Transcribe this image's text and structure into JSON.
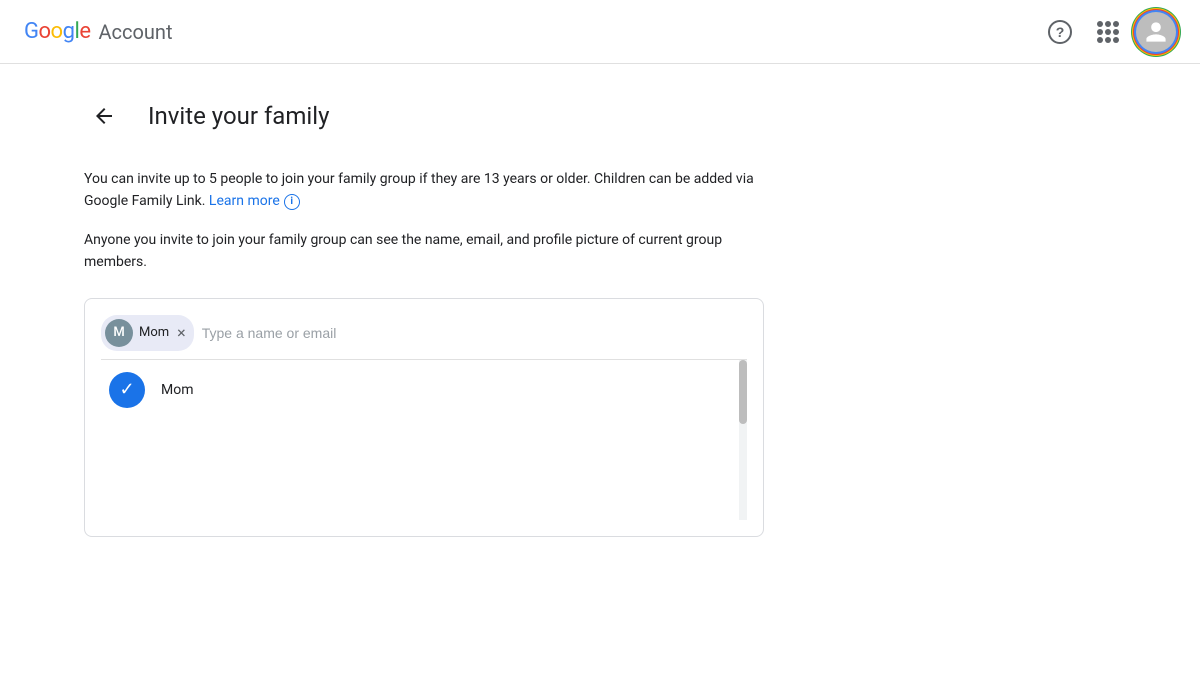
{
  "header": {
    "google_logo": {
      "g": "G",
      "o1": "o",
      "o2": "o",
      "g2": "g",
      "l": "l",
      "e": "e"
    },
    "account_text": "Account",
    "help_label": "?",
    "apps_label": "Google apps",
    "profile_label": "Google Account"
  },
  "page": {
    "back_label": "←",
    "title": "Invite your family",
    "description1": "You can invite up to 5 people to join your family group if they are 13 years or older. Children can be added via Google Family Link.",
    "learn_more_text": "Learn more",
    "learn_more_icon": "ℹ",
    "description2": "Anyone you invite to join your family group can see the name, email, and profile picture of current group members."
  },
  "input": {
    "chip_label": "Mom",
    "chip_initial": "M",
    "chip_close": "×",
    "placeholder": "Type a name or email"
  },
  "dropdown": {
    "items": [
      {
        "name": "Mom",
        "selected": true
      }
    ]
  }
}
